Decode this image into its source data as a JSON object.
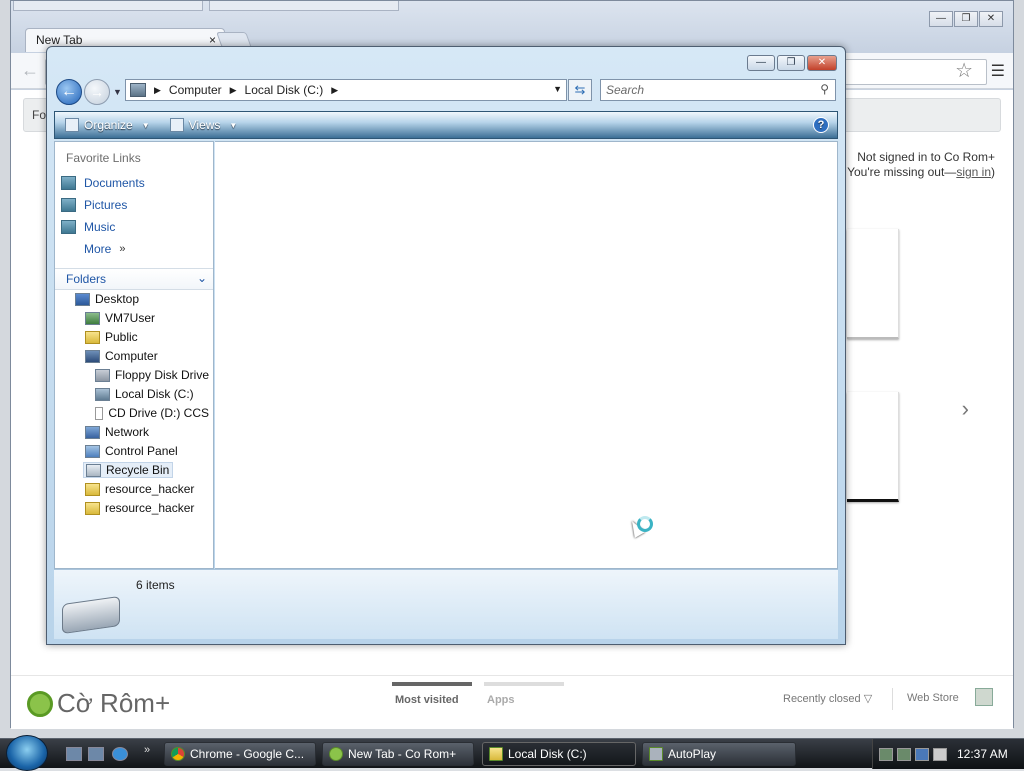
{
  "chrome": {
    "tab_title": "New Tab",
    "tab_close": "×",
    "back_glyph": "←",
    "win_buttons": [
      "—",
      "❐",
      "✕"
    ],
    "fakebox_text": "For",
    "signin_line1": "Not signed in to Co Rom+",
    "signin_line2_prefix": "You're missing out—",
    "signin_link": "sign in",
    "signin_suffix": ")",
    "next_chevron": "›",
    "logo_text": "Cờ Rôm+",
    "footer": {
      "most_visited": "Most visited",
      "apps": "Apps",
      "recently_closed": "Recently closed ▽",
      "web_store": "Web Store"
    }
  },
  "explorer": {
    "win_buttons": [
      "—",
      "❐",
      "✕"
    ],
    "address": {
      "segments": [
        "Computer",
        "Local Disk (C:)"
      ]
    },
    "search_placeholder": "Search",
    "command_bar": {
      "organize": "Organize",
      "views": "Views",
      "help": "?"
    },
    "favorite_links_header": "Favorite Links",
    "favorite_links": [
      "Documents",
      "Pictures",
      "Music",
      "More"
    ],
    "more_chevron": "»",
    "folders_header": "Folders",
    "tree": [
      {
        "label": "Desktop",
        "icon": "desktop-icon"
      },
      {
        "label": "VM7User",
        "icon": "user-folder-icon"
      },
      {
        "label": "Public",
        "icon": "folder-icon"
      },
      {
        "label": "Computer",
        "icon": "computer-icon"
      },
      {
        "label": "Floppy Disk Drive",
        "icon": "floppy-icon"
      },
      {
        "label": "Local Disk (C:)",
        "icon": "disk-icon"
      },
      {
        "label": "CD Drive (D:) CCS",
        "icon": "cd-icon"
      },
      {
        "label": "Network",
        "icon": "network-icon"
      },
      {
        "label": "Control Panel",
        "icon": "control-panel-icon"
      },
      {
        "label": "Recycle Bin",
        "icon": "recycle-bin-icon"
      },
      {
        "label": "resource_hacker",
        "icon": "folder-icon"
      },
      {
        "label": "resource_hacker",
        "icon": "zip-folder-icon"
      }
    ],
    "status_count": "6 items"
  },
  "taskbar": {
    "quicklaunch_more": "»",
    "buttons": [
      {
        "label": "Chrome - Google C...",
        "icon": "chrome-icon"
      },
      {
        "label": "New Tab - Co Rom+",
        "icon": "corom-icon"
      },
      {
        "label": "Local Disk (C:)",
        "icon": "folder-icon"
      },
      {
        "label": "AutoPlay",
        "icon": "autoplay-icon"
      }
    ],
    "clock": "12:37 AM"
  },
  "colors": {
    "explorer_frame": "#b8d3ea",
    "command_bar": "#3c6f96",
    "link_blue": "#1f56a6",
    "taskbar": "#111417"
  }
}
